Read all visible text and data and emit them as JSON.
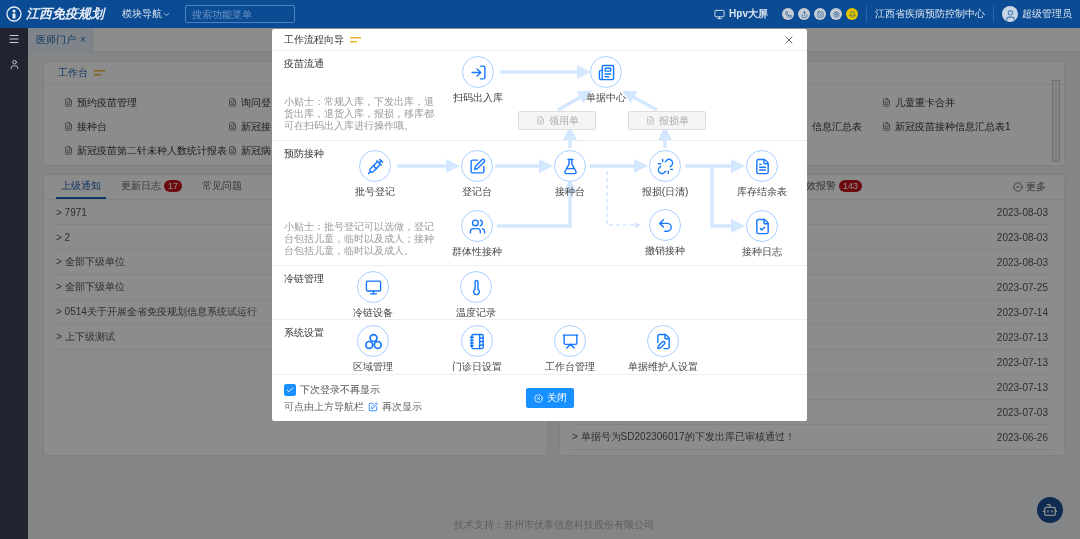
{
  "header": {
    "logo_text": "江西免疫规划",
    "module_nav": "模块导航",
    "search": {
      "placeholder": "搜索功能菜单"
    },
    "big_screen": "Hpv大屏",
    "organization": "江西省疾病预防控制中心",
    "user": "超级管理员"
  },
  "page_tabs": [
    {
      "label": "医师门户",
      "close": "×",
      "selected": true
    }
  ],
  "workbench": {
    "title": "工作台",
    "left_items": [
      {
        "label": "预约疫苗管理"
      },
      {
        "label": "询问登"
      },
      {
        "label": "接种台"
      },
      {
        "label": "新冠接"
      },
      {
        "label": "新冠疫苗第二针未种人数统计报表"
      },
      {
        "label": "新冠病"
      }
    ],
    "right_items": [
      {
        "label": "儿童重卡合并",
        "kind": "document"
      },
      {
        "label": "信息汇总表",
        "kind": "cut"
      },
      {
        "label": "新冠疫苗接种信息汇总表1",
        "kind": "document"
      }
    ]
  },
  "notices": {
    "tabs": [
      {
        "label": "上级通知",
        "selected": true
      },
      {
        "label": "更新日志",
        "badge": "17",
        "selected": false
      },
      {
        "label": "常见问题",
        "selected": false
      }
    ],
    "rows": [
      "> 7971",
      "> 2",
      "> 全部下级单位",
      "> 全部下级单位",
      "> 0514关于开展全省免疫规划信息系统试运行",
      "> 上下级测试"
    ]
  },
  "alerts": {
    "tab": {
      "label": "效报警",
      "badge": "143"
    },
    "more": "更多",
    "rows": [
      {
        "date": "2023-08-03"
      },
      {
        "date": "2023-08-03"
      },
      {
        "date": "2023-08-03"
      },
      {
        "date": "2023-07-25"
      },
      {
        "date": "2023-07-14"
      },
      {
        "date": "2023-07-13"
      },
      {
        "date": "2023-07-13"
      },
      {
        "date": "2023-07-13"
      },
      {
        "date": "2023-07-03"
      },
      {
        "text": "> 单据号为SD202306017的下发出库已审核通过！",
        "date": "2023-06-26"
      }
    ]
  },
  "footer": "技术支持：苏州市伏泰信息科技股份有限公司",
  "modal": {
    "title": "工作流程向导",
    "sections": [
      {
        "title": "疫苗流通",
        "tip": "小贴士：常规入库，下发出库，退货出库，退货入库，报损，移库都可在扫码出入库进行操作哦。",
        "nodes": [
          "扫码出入库",
          "单据中心"
        ],
        "forms": [
          {
            "label": "领用单",
            "disabled": true
          },
          {
            "label": "报损单",
            "disabled": true
          }
        ]
      },
      {
        "title": "预防接种",
        "tip": "小贴士：批号登记可以选做，登记台包括儿童，临时以及成人；接种台包括儿童，临时以及成人。",
        "nodes": [
          "批号登记",
          "登记台",
          "接种台",
          "报损(日清)",
          "库存结余表",
          "群体性接种",
          "撤销接种",
          "接种日志"
        ]
      },
      {
        "title": "冷链管理",
        "nodes": [
          "冷链设备",
          "温度记录"
        ]
      },
      {
        "title": "系统设置",
        "nodes": [
          "区域管理",
          "门诊日设置",
          "工作台管理",
          "单据维护人设置"
        ]
      }
    ],
    "dont_show": {
      "label": "下次登录不再显示",
      "checked": true
    },
    "hint_before": "可点由上方导航栏",
    "hint_after": "再次显示",
    "close_button": "关闭"
  }
}
